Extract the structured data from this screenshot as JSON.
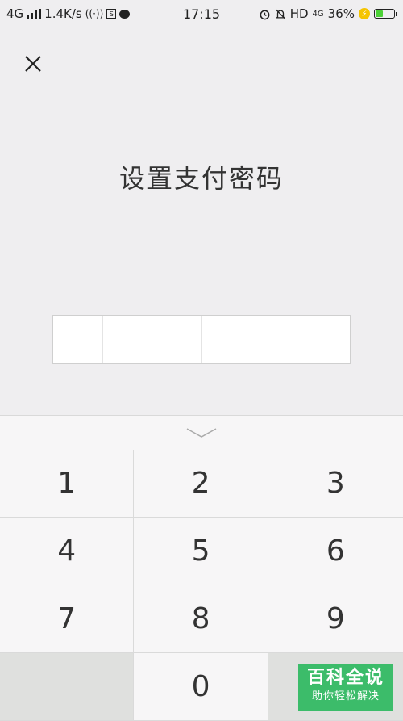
{
  "status_bar": {
    "network_type": "4G",
    "speed": "1.4K/s",
    "time": "17:15",
    "hd": "HD",
    "network_type_right": "4G",
    "battery": "36%",
    "battery_level": 0.36
  },
  "header": {
    "close_icon": "close-icon"
  },
  "main": {
    "title": "设置支付密码",
    "pin_length": 6
  },
  "keypad": {
    "collapse_icon": "chevron-down-icon",
    "keys": [
      "1",
      "2",
      "3",
      "4",
      "5",
      "6",
      "7",
      "8",
      "9",
      "",
      "0",
      ""
    ]
  },
  "watermark": {
    "title": "百科全说",
    "subtitle": "助你轻松解决"
  },
  "colors": {
    "background": "#efeef0",
    "keypad_bg": "#f7f6f7",
    "blank_key": "#dfe0de",
    "watermark_green": "#3cbc6a",
    "battery_green": "#4cd137"
  }
}
